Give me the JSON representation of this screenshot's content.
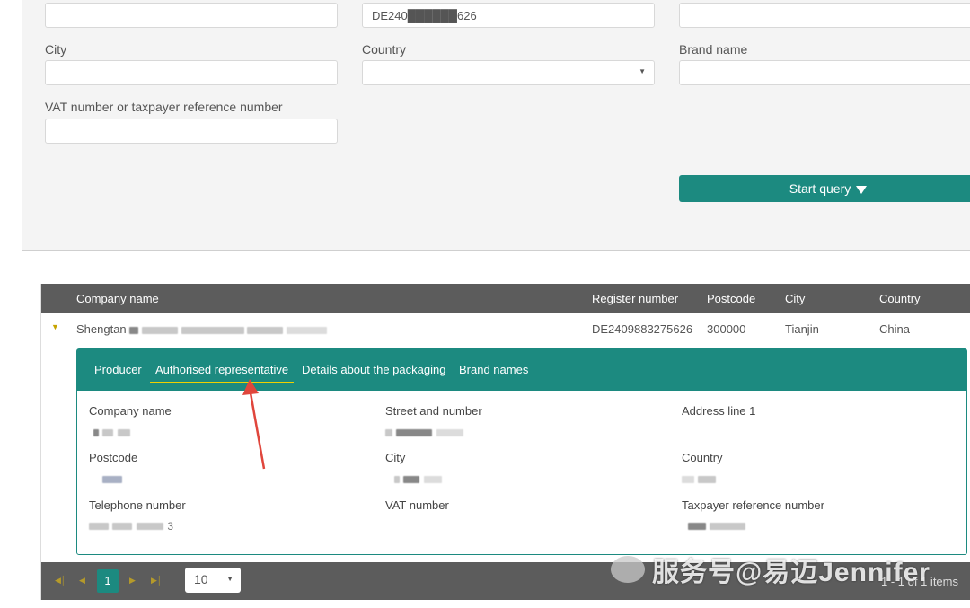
{
  "search": {
    "fields": [
      {
        "label": "",
        "value": ""
      },
      {
        "label": "",
        "value": "DE240██████626"
      },
      {
        "label": "",
        "value": ""
      },
      {
        "label": "City",
        "value": ""
      },
      {
        "label": "Country",
        "value": ""
      },
      {
        "label": "Brand name",
        "value": ""
      },
      {
        "label": "VAT number or taxpayer reference number",
        "value": ""
      }
    ],
    "start_query_label": "Start query"
  },
  "grid": {
    "columns": [
      "Company name",
      "Register number",
      "Postcode",
      "City",
      "Country"
    ],
    "row": {
      "company": "Shengtan",
      "register_number": "DE2409883275626",
      "postcode": "300000",
      "city": "Tianjin",
      "country": "China"
    },
    "detail_tabs": [
      "Producer",
      "Authorised representative",
      "Details about the packaging",
      "Brand names"
    ],
    "active_tab": "Authorised representative",
    "detail_fields": {
      "company_name": "Company name",
      "street": "Street and number",
      "address1": "Address line 1",
      "postcode": "Postcode",
      "city": "City",
      "country": "Country",
      "telephone": "Telephone number",
      "vat": "VAT number",
      "taxpayer": "Taxpayer reference number"
    },
    "telephone_partial": "3"
  },
  "pager": {
    "current_page": "1",
    "page_size": "10",
    "info": "1 - 1 of 1 items"
  },
  "watermark": "服务号@易迈Jennifer",
  "colors": {
    "teal": "#1c8a80",
    "header": "#5c5c5c",
    "accent": "#f0d000",
    "arrow": "#e0463c"
  }
}
